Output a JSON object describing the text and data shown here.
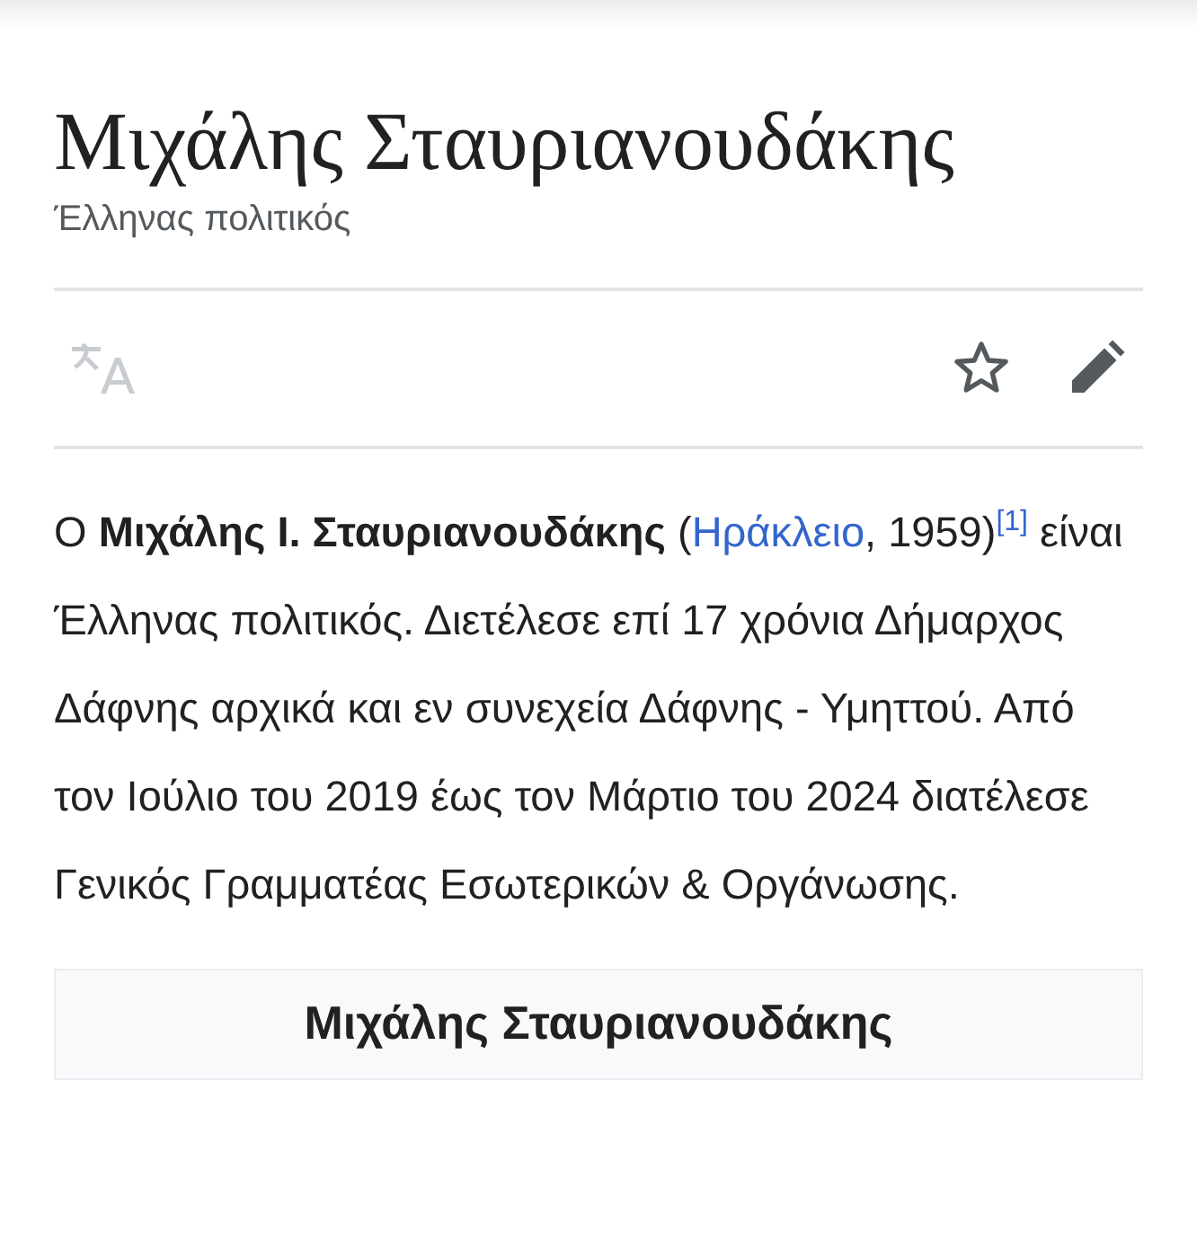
{
  "page": {
    "title": "Μιχάλης Σταυριανουδάκης",
    "description": "Έλληνας πολιτικός"
  },
  "actions": {
    "language": {
      "disabled": true
    },
    "watch": {
      "selected": false
    },
    "edit": {
      "disabled": false
    }
  },
  "intro": [
    {
      "kind": "text",
      "text": "Ο **Μιχάλης Ι. Σταυριανουδάκης** ("
    },
    {
      "kind": "link",
      "text": "Ηράκλειο"
    },
    {
      "kind": "text",
      "text": ", 1959)"
    },
    {
      "kind": "ref",
      "text": "[1]"
    },
    {
      "kind": "text",
      "text": " είναι Έλληνας πολιτικός. Διετέλεσε επί 17 χρόνια Δήμαρχος Δάφνης αρχικά και εν συνεχεία Δάφνης - Υμηττού. Από τον Ιούλιο του 2019 έως τον Μάρτιο του 2024 διατέλεσε Γενικός Γραμματέας Εσωτερικών & Οργάνωσης."
    }
  ],
  "infobox": {
    "title": "Μιχάλης Σταυριανουδάκης"
  }
}
